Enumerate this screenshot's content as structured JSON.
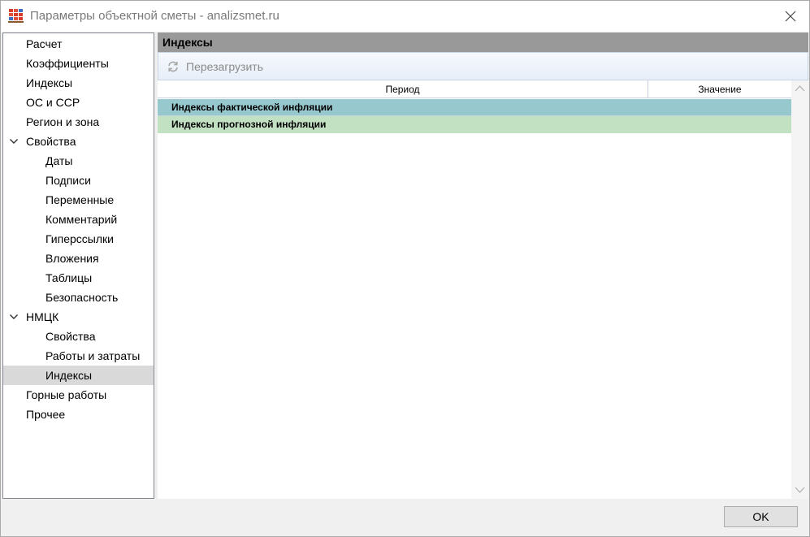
{
  "window": {
    "title": "Параметры объектной сметы - analizsmet.ru"
  },
  "nav": {
    "items": [
      {
        "label": "Расчет",
        "level": 0
      },
      {
        "label": "Коэффициенты",
        "level": 0
      },
      {
        "label": "Индексы",
        "level": 0
      },
      {
        "label": "ОС и ССР",
        "level": 0
      },
      {
        "label": "Регион и зона",
        "level": 0
      },
      {
        "label": "Свойства",
        "level": 0,
        "expanded": true
      },
      {
        "label": "Даты",
        "level": 1
      },
      {
        "label": "Подписи",
        "level": 1
      },
      {
        "label": "Переменные",
        "level": 1
      },
      {
        "label": "Комментарий",
        "level": 1
      },
      {
        "label": "Гиперссылки",
        "level": 1
      },
      {
        "label": "Вложения",
        "level": 1
      },
      {
        "label": "Таблицы",
        "level": 1
      },
      {
        "label": "Безопасность",
        "level": 1
      },
      {
        "label": "НМЦК",
        "level": 0,
        "expanded": true
      },
      {
        "label": "Свойства",
        "level": 1
      },
      {
        "label": "Работы и затраты",
        "level": 1
      },
      {
        "label": "Индексы",
        "level": 1,
        "selected": true
      },
      {
        "label": "Горные работы",
        "level": 0
      },
      {
        "label": "Прочее",
        "level": 0
      }
    ]
  },
  "panel": {
    "header": "Индексы",
    "toolbar": {
      "reload_label": "Перезагрузить",
      "reload_icon": "refresh-icon"
    },
    "grid": {
      "columns": [
        "Период",
        "Значение"
      ],
      "groups": [
        {
          "label": "Индексы фактической инфляции",
          "color": "#97c8ce"
        },
        {
          "label": "Индексы прогнозной инфляции",
          "color": "#c2e0c2"
        }
      ]
    }
  },
  "footer": {
    "ok_label": "OK"
  }
}
